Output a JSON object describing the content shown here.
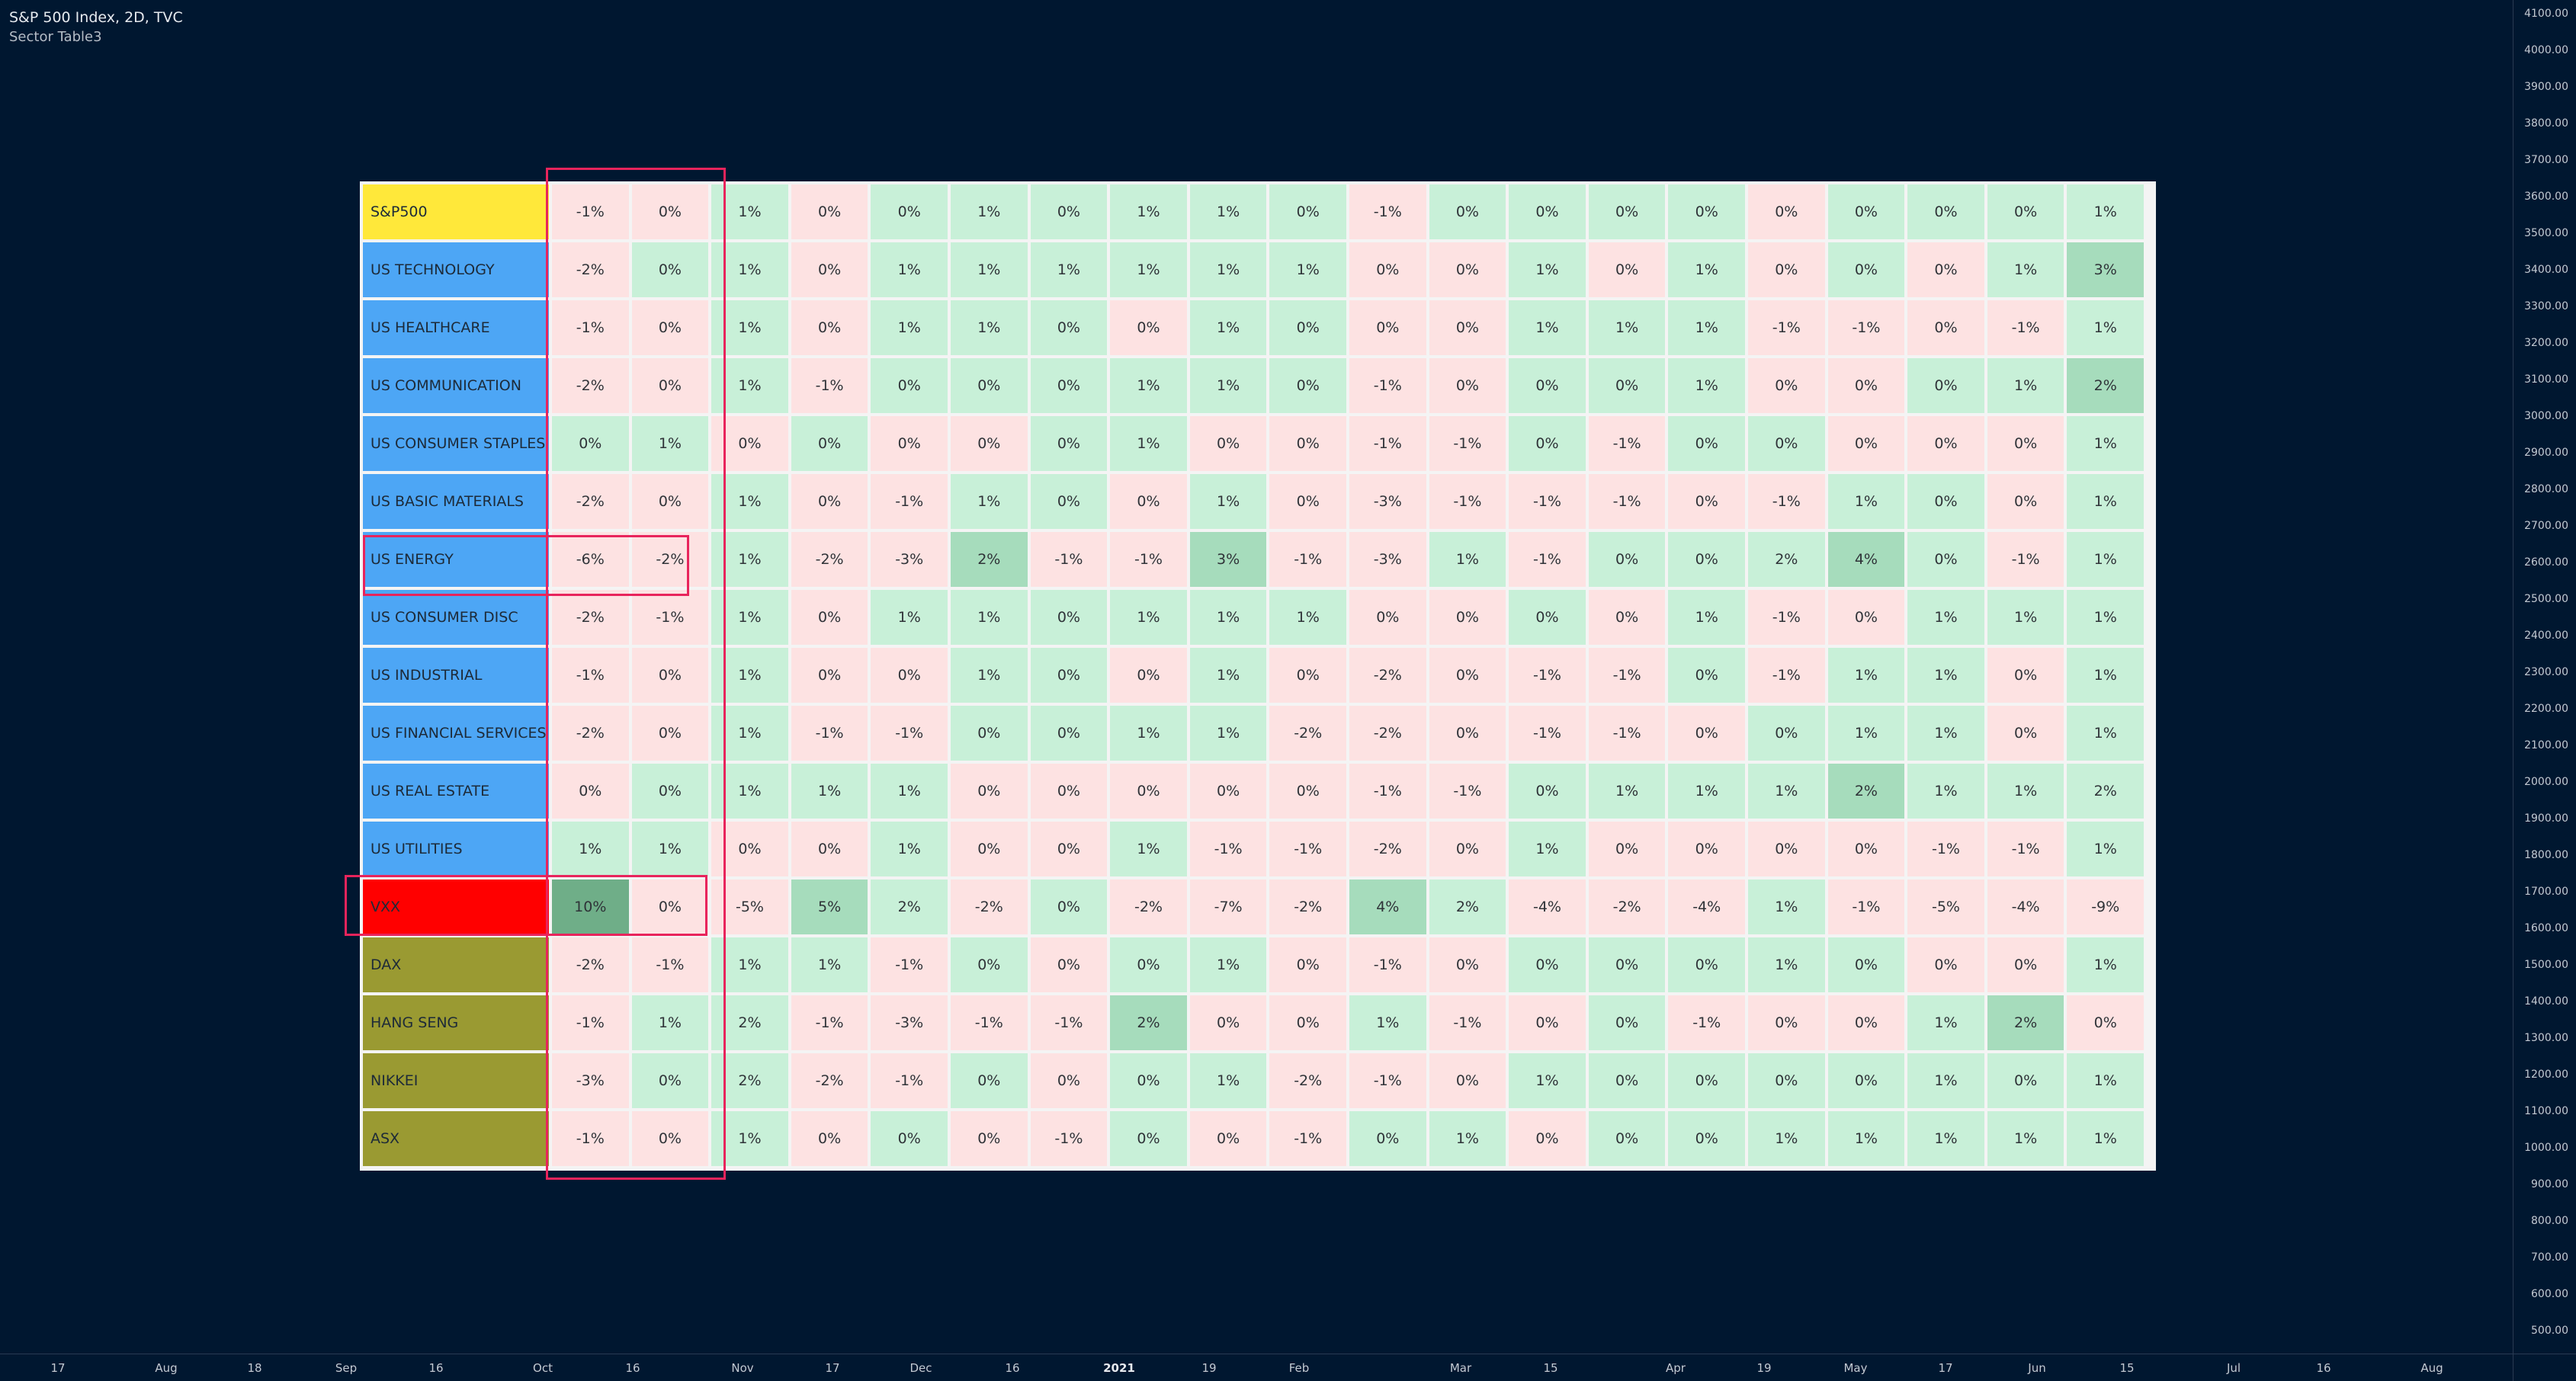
{
  "legend": {
    "title": "S&P 500 Index, 2D, TVC",
    "indicator": "Sector Table3"
  },
  "price_axis": {
    "labels": [
      "4100.00",
      "4000.00",
      "3900.00",
      "3800.00",
      "3700.00",
      "3600.00",
      "3500.00",
      "3400.00",
      "3300.00",
      "3200.00",
      "3100.00",
      "3000.00",
      "2900.00",
      "2800.00",
      "2700.00",
      "2600.00",
      "2500.00",
      "2400.00",
      "2300.00",
      "2200.00",
      "2100.00",
      "2000.00",
      "1900.00",
      "1800.00",
      "1700.00",
      "1600.00",
      "1500.00",
      "1400.00",
      "1300.00",
      "1200.00",
      "1100.00",
      "1000.00",
      "900.00",
      "800.00",
      "700.00",
      "600.00",
      "500.00"
    ]
  },
  "time_axis": {
    "labels": [
      {
        "text": "17"
      },
      {
        "text": "Aug"
      },
      {
        "text": "18"
      },
      {
        "text": "Sep"
      },
      {
        "text": "16"
      },
      {
        "text": "Oct"
      },
      {
        "text": "16"
      },
      {
        "text": "Nov"
      },
      {
        "text": "17"
      },
      {
        "text": "Dec"
      },
      {
        "text": "16"
      },
      {
        "text": "2021",
        "bold": true
      },
      {
        "text": "19"
      },
      {
        "text": "Feb"
      },
      {
        "text": "Mar"
      },
      {
        "text": "15"
      },
      {
        "text": "Apr"
      },
      {
        "text": "19"
      },
      {
        "text": "May"
      },
      {
        "text": "17"
      },
      {
        "text": "Jun"
      },
      {
        "text": "15"
      },
      {
        "text": "Jul"
      },
      {
        "text": "16"
      },
      {
        "text": "Aug"
      }
    ]
  },
  "colors": {
    "background": "#001730",
    "label_yellow": "#ffe83a",
    "label_blue": "#4da6f5",
    "label_red": "#ff0000",
    "label_olive": "#9a9a32",
    "positive_light": "#c8f0d8",
    "positive_medium": "#a6dcbc",
    "positive_strong": "#6fae88",
    "negative_light": "#fde2e2",
    "highlight_border": "#e8245c"
  },
  "table": {
    "rows": [
      {
        "label": "S&P500",
        "color": "yellow",
        "values": [
          "-1%",
          "0%",
          "1%",
          "0%",
          "0%",
          "1%",
          "0%",
          "1%",
          "1%",
          "0%",
          "-1%",
          "0%",
          "0%",
          "0%",
          "0%",
          "0%",
          "0%",
          "0%",
          "0%",
          "1%"
        ],
        "signs": [
          "n",
          "n",
          "p",
          "n",
          "p",
          "p",
          "p",
          "p",
          "p",
          "p",
          "n",
          "p",
          "p",
          "p",
          "p",
          "n",
          "p",
          "p",
          "p",
          "p"
        ]
      },
      {
        "label": "US TECHNOLOGY",
        "color": "blue",
        "values": [
          "-2%",
          "0%",
          "1%",
          "0%",
          "1%",
          "1%",
          "1%",
          "1%",
          "1%",
          "1%",
          "0%",
          "0%",
          "1%",
          "0%",
          "1%",
          "0%",
          "0%",
          "0%",
          "1%",
          "3%"
        ],
        "signs": [
          "n",
          "p",
          "p",
          "n",
          "p",
          "p",
          "p",
          "p",
          "p",
          "p",
          "n",
          "n",
          "p",
          "n",
          "p",
          "n",
          "p",
          "n",
          "p",
          "pm"
        ]
      },
      {
        "label": "US HEALTHCARE",
        "color": "blue",
        "values": [
          "-1%",
          "0%",
          "1%",
          "0%",
          "1%",
          "1%",
          "0%",
          "0%",
          "1%",
          "0%",
          "0%",
          "0%",
          "1%",
          "1%",
          "1%",
          "-1%",
          "-1%",
          "0%",
          "-1%",
          "1%"
        ],
        "signs": [
          "n",
          "n",
          "p",
          "n",
          "p",
          "p",
          "p",
          "n",
          "p",
          "p",
          "n",
          "n",
          "p",
          "p",
          "p",
          "n",
          "n",
          "n",
          "n",
          "p"
        ]
      },
      {
        "label": "US COMMUNICATION",
        "color": "blue",
        "values": [
          "-2%",
          "0%",
          "1%",
          "-1%",
          "0%",
          "0%",
          "0%",
          "1%",
          "1%",
          "0%",
          "-1%",
          "0%",
          "0%",
          "0%",
          "1%",
          "0%",
          "0%",
          "0%",
          "1%",
          "2%"
        ],
        "signs": [
          "n",
          "n",
          "p",
          "n",
          "p",
          "p",
          "p",
          "p",
          "p",
          "p",
          "n",
          "n",
          "p",
          "p",
          "p",
          "n",
          "n",
          "p",
          "p",
          "pm"
        ]
      },
      {
        "label": "US CONSUMER STAPLES",
        "color": "blue",
        "values": [
          "0%",
          "1%",
          "0%",
          "0%",
          "0%",
          "0%",
          "0%",
          "1%",
          "0%",
          "0%",
          "-1%",
          "-1%",
          "0%",
          "-1%",
          "0%",
          "0%",
          "0%",
          "0%",
          "0%",
          "1%"
        ],
        "signs": [
          "p",
          "p",
          "n",
          "p",
          "n",
          "n",
          "p",
          "p",
          "n",
          "n",
          "n",
          "n",
          "p",
          "n",
          "p",
          "p",
          "n",
          "n",
          "n",
          "p"
        ]
      },
      {
        "label": "US BASIC MATERIALS",
        "color": "blue",
        "values": [
          "-2%",
          "0%",
          "1%",
          "0%",
          "-1%",
          "1%",
          "0%",
          "0%",
          "1%",
          "0%",
          "-3%",
          "-1%",
          "-1%",
          "-1%",
          "0%",
          "-1%",
          "1%",
          "0%",
          "0%",
          "1%"
        ],
        "signs": [
          "n",
          "n",
          "p",
          "n",
          "n",
          "p",
          "p",
          "n",
          "p",
          "n",
          "n",
          "n",
          "n",
          "n",
          "n",
          "n",
          "p",
          "p",
          "n",
          "p"
        ]
      },
      {
        "label": "US ENERGY",
        "color": "blue",
        "values": [
          "-6%",
          "-2%",
          "1%",
          "-2%",
          "-3%",
          "2%",
          "-1%",
          "-1%",
          "3%",
          "-1%",
          "-3%",
          "1%",
          "-1%",
          "0%",
          "0%",
          "2%",
          "4%",
          "0%",
          "-1%",
          "1%"
        ],
        "signs": [
          "n",
          "n",
          "p",
          "n",
          "n",
          "pm",
          "n",
          "n",
          "pm",
          "n",
          "n",
          "p",
          "n",
          "p",
          "p",
          "p",
          "pm",
          "p",
          "n",
          "p"
        ]
      },
      {
        "label": "US CONSUMER DISC",
        "color": "blue",
        "values": [
          "-2%",
          "-1%",
          "1%",
          "0%",
          "1%",
          "1%",
          "0%",
          "1%",
          "1%",
          "1%",
          "0%",
          "0%",
          "0%",
          "0%",
          "1%",
          "-1%",
          "0%",
          "1%",
          "1%",
          "1%"
        ],
        "signs": [
          "n",
          "n",
          "p",
          "n",
          "p",
          "p",
          "p",
          "p",
          "p",
          "p",
          "n",
          "n",
          "p",
          "n",
          "p",
          "n",
          "n",
          "p",
          "p",
          "p"
        ]
      },
      {
        "label": "US INDUSTRIAL",
        "color": "blue",
        "values": [
          "-1%",
          "0%",
          "1%",
          "0%",
          "0%",
          "1%",
          "0%",
          "0%",
          "1%",
          "0%",
          "-2%",
          "0%",
          "-1%",
          "-1%",
          "0%",
          "-1%",
          "1%",
          "1%",
          "0%",
          "1%"
        ],
        "signs": [
          "n",
          "n",
          "p",
          "n",
          "n",
          "p",
          "p",
          "n",
          "p",
          "n",
          "n",
          "n",
          "n",
          "n",
          "p",
          "n",
          "p",
          "p",
          "n",
          "p"
        ]
      },
      {
        "label": "US FINANCIAL SERVICES",
        "color": "blue",
        "values": [
          "-2%",
          "0%",
          "1%",
          "-1%",
          "-1%",
          "0%",
          "0%",
          "1%",
          "1%",
          "-2%",
          "-2%",
          "0%",
          "-1%",
          "-1%",
          "0%",
          "0%",
          "1%",
          "1%",
          "0%",
          "1%"
        ],
        "signs": [
          "n",
          "n",
          "p",
          "n",
          "n",
          "p",
          "p",
          "p",
          "p",
          "n",
          "n",
          "n",
          "n",
          "n",
          "n",
          "p",
          "p",
          "p",
          "n",
          "p"
        ]
      },
      {
        "label": "US REAL ESTATE",
        "color": "blue",
        "values": [
          "0%",
          "0%",
          "1%",
          "1%",
          "1%",
          "0%",
          "0%",
          "0%",
          "0%",
          "0%",
          "-1%",
          "-1%",
          "0%",
          "1%",
          "1%",
          "1%",
          "2%",
          "1%",
          "1%",
          "2%"
        ],
        "signs": [
          "n",
          "p",
          "p",
          "p",
          "p",
          "n",
          "n",
          "n",
          "n",
          "n",
          "n",
          "n",
          "p",
          "p",
          "p",
          "p",
          "pm",
          "p",
          "p",
          "p"
        ]
      },
      {
        "label": "US UTILITIES",
        "color": "blue",
        "values": [
          "1%",
          "1%",
          "0%",
          "0%",
          "1%",
          "0%",
          "0%",
          "1%",
          "-1%",
          "-1%",
          "-2%",
          "0%",
          "1%",
          "0%",
          "0%",
          "0%",
          "0%",
          "-1%",
          "-1%",
          "1%"
        ],
        "signs": [
          "p",
          "p",
          "n",
          "n",
          "p",
          "n",
          "n",
          "p",
          "n",
          "n",
          "n",
          "n",
          "p",
          "n",
          "n",
          "n",
          "n",
          "n",
          "n",
          "p"
        ]
      },
      {
        "label": "VXX",
        "color": "red",
        "values": [
          "10%",
          "0%",
          "-5%",
          "5%",
          "2%",
          "-2%",
          "0%",
          "-2%",
          "-7%",
          "-2%",
          "4%",
          "2%",
          "-4%",
          "-2%",
          "-4%",
          "1%",
          "-1%",
          "-5%",
          "-4%",
          "-9%"
        ],
        "signs": [
          "ps",
          "n",
          "n",
          "pm",
          "p",
          "n",
          "p",
          "n",
          "n",
          "n",
          "pm",
          "p",
          "n",
          "n",
          "n",
          "p",
          "n",
          "n",
          "n",
          "n"
        ]
      },
      {
        "label": "DAX",
        "color": "olive",
        "values": [
          "-2%",
          "-1%",
          "1%",
          "1%",
          "-1%",
          "0%",
          "0%",
          "0%",
          "1%",
          "0%",
          "-1%",
          "0%",
          "0%",
          "0%",
          "0%",
          "1%",
          "0%",
          "0%",
          "0%",
          "1%"
        ],
        "signs": [
          "n",
          "n",
          "p",
          "p",
          "n",
          "p",
          "n",
          "p",
          "p",
          "n",
          "n",
          "n",
          "p",
          "p",
          "p",
          "p",
          "p",
          "n",
          "n",
          "p"
        ]
      },
      {
        "label": "HANG SENG",
        "color": "olive",
        "values": [
          "-1%",
          "1%",
          "2%",
          "-1%",
          "-3%",
          "-1%",
          "-1%",
          "2%",
          "0%",
          "0%",
          "1%",
          "-1%",
          "0%",
          "0%",
          "-1%",
          "0%",
          "0%",
          "1%",
          "2%",
          "0%"
        ],
        "signs": [
          "n",
          "p",
          "p",
          "n",
          "n",
          "n",
          "n",
          "pm",
          "n",
          "n",
          "p",
          "n",
          "n",
          "p",
          "n",
          "n",
          "n",
          "p",
          "pm",
          "n"
        ]
      },
      {
        "label": "NIKKEI",
        "color": "olive",
        "values": [
          "-3%",
          "0%",
          "2%",
          "-2%",
          "-1%",
          "0%",
          "0%",
          "0%",
          "1%",
          "-2%",
          "-1%",
          "0%",
          "1%",
          "0%",
          "0%",
          "0%",
          "0%",
          "1%",
          "0%",
          "1%"
        ],
        "signs": [
          "n",
          "p",
          "p",
          "n",
          "n",
          "p",
          "n",
          "p",
          "p",
          "n",
          "n",
          "n",
          "p",
          "p",
          "p",
          "p",
          "p",
          "p",
          "p",
          "p"
        ]
      },
      {
        "label": "ASX",
        "color": "olive",
        "values": [
          "-1%",
          "0%",
          "1%",
          "0%",
          "0%",
          "0%",
          "-1%",
          "0%",
          "0%",
          "-1%",
          "0%",
          "1%",
          "0%",
          "0%",
          "0%",
          "1%",
          "1%",
          "1%",
          "1%",
          "1%"
        ],
        "signs": [
          "n",
          "n",
          "p",
          "n",
          "p",
          "n",
          "n",
          "p",
          "n",
          "n",
          "p",
          "p",
          "n",
          "p",
          "p",
          "p",
          "p",
          "p",
          "p",
          "p"
        ]
      }
    ]
  }
}
